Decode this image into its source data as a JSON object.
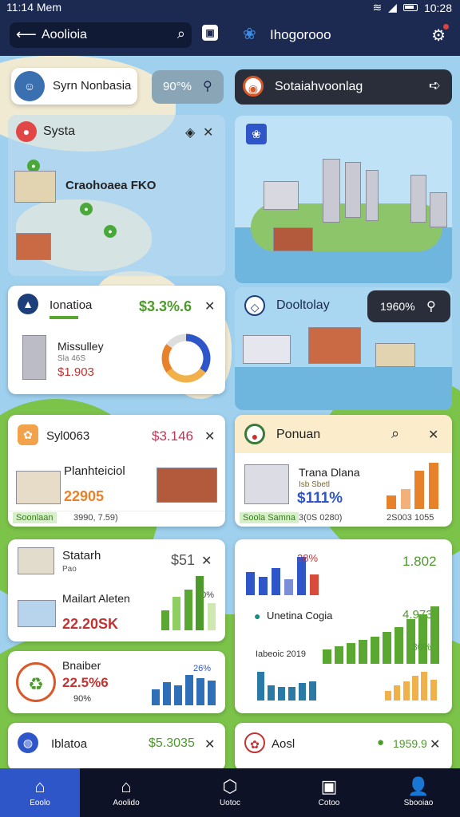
{
  "status": {
    "time": "11:14 Mem",
    "clock": "10:28"
  },
  "header": {
    "search_text": "Aoolioia",
    "title": "Ihogorooo"
  },
  "profile": {
    "name": "Syrn Nonbasia",
    "badge": "90°%"
  },
  "top_banner": {
    "label": "Sotaiahvoonlag"
  },
  "map_card": {
    "title": "Systa",
    "label": "Craohoaea FKO"
  },
  "card_a": {
    "title": "Ionatioa",
    "price": "$3.3%.6",
    "subtitle": "Missulley",
    "small": "Sla 46S",
    "value": "$1.903"
  },
  "card_b": {
    "title": "Dooltolay",
    "badge": "1960%"
  },
  "card_c": {
    "title": "Syl0063",
    "price": "$3.146",
    "name": "Planhteiciol",
    "value": "22905",
    "footer_a": "Soonlaan",
    "footer_b": "3990, 7.59)"
  },
  "card_d": {
    "title": "Ponuan",
    "name": "Trana Dlana",
    "small": "Isb Sbetl",
    "pct": "$111%",
    "footer_a": "Soola Samna",
    "footer_b": "3(0S 0280)",
    "footer_c": "2S003 1055"
  },
  "card_e": {
    "title": "Statarh",
    "sub": "Pao",
    "price": "$51",
    "name": "Mailart Aleten",
    "value": "22.20SK",
    "pct": "60%"
  },
  "card_f": {
    "pct": "28%",
    "value": "1.802",
    "label": "Unetina Cogia",
    "value2": "4.9736",
    "footer": "Iabeoic 2019",
    "pct2": "30%",
    "bars_left": [
      38,
      30,
      44,
      26,
      62,
      34
    ],
    "bars_green": [
      18,
      22,
      26,
      30,
      34,
      40,
      46,
      56,
      62,
      72
    ],
    "bars_blue": [
      30,
      16,
      14,
      14,
      18,
      20
    ],
    "bars_orange": [
      10,
      16,
      20,
      26,
      30,
      22
    ]
  },
  "card_g": {
    "title": "Bnaiber",
    "value": "22.5%6",
    "small": "90%",
    "pct": "26%",
    "bars": [
      18,
      26,
      22,
      34,
      30,
      28
    ]
  },
  "card_h": {
    "title": "Iblatoa",
    "price": "$5.3035"
  },
  "card_i": {
    "title": "Aosl",
    "value": "1959.9"
  },
  "card_a_chart": {
    "values": [
      35,
      30,
      20,
      15
    ]
  },
  "card_c_bars": [
    0.0
  ],
  "card_d_bars": [
    16,
    24,
    46,
    56
  ],
  "card_e_bars": [
    30,
    50,
    60,
    80,
    40
  ],
  "nav": [
    {
      "label": "Eoolo"
    },
    {
      "label": "Aoolido"
    },
    {
      "label": "Uotoc"
    },
    {
      "label": "Cotoo"
    },
    {
      "label": "Sbooiao"
    }
  ],
  "colors": {
    "primary": "#1c2a52",
    "accent": "#2f56c9",
    "green": "#5aa832",
    "orange": "#e8822a"
  }
}
